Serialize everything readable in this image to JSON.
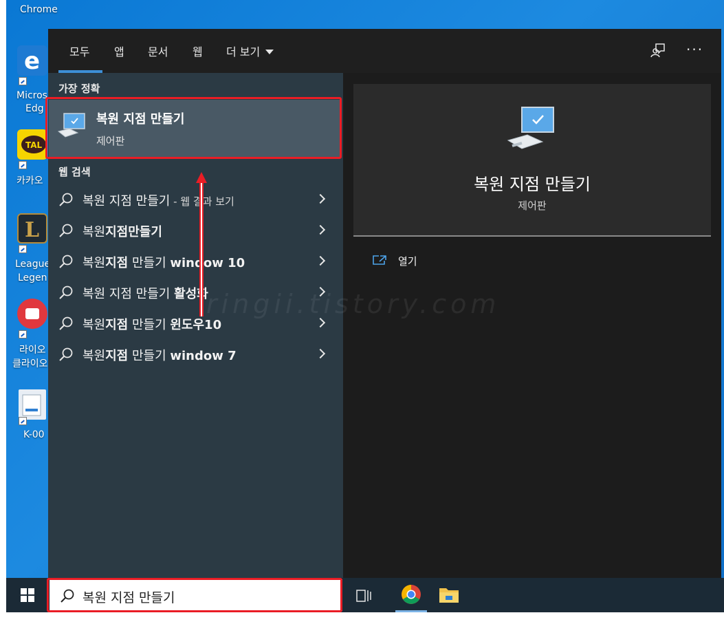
{
  "desktop": {
    "icons": [
      {
        "label": "Chrome"
      },
      {
        "label": "Micros"
      },
      {
        "label": "Edg"
      },
      {
        "label": "카카오"
      },
      {
        "label": "League"
      },
      {
        "label": "Legen"
      },
      {
        "label": "라이오"
      },
      {
        "label": "클라이오"
      },
      {
        "label": "K-00"
      }
    ]
  },
  "header": {
    "tabs": [
      {
        "label": "모두"
      },
      {
        "label": "앱"
      },
      {
        "label": "문서"
      },
      {
        "label": "웹"
      },
      {
        "label": "더 보기"
      }
    ],
    "more_options": "···"
  },
  "best_match": {
    "heading": "가장 정확",
    "title": "복원 지점 만들기",
    "subtitle": "제어판"
  },
  "web_search": {
    "heading": "웹 검색",
    "items": [
      {
        "plain": "복원 지점 만들기",
        "bold": "",
        "suffix": " - 웹 결과 보기"
      },
      {
        "plain": "복원",
        "bold": "지점만들기",
        "suffix": ""
      },
      {
        "plain": "복원",
        "bold": "지점",
        "tail": " 만들기 ",
        "bold2": "window 10"
      },
      {
        "plain": "복원 지점 만들기 ",
        "bold": "활성화",
        "suffix": ""
      },
      {
        "plain": "복원",
        "bold": "지점",
        "tail": " 만들기 ",
        "bold2": "윈도우10"
      },
      {
        "plain": "복원",
        "bold": "지점",
        "tail": " 만들기 ",
        "bold2": "window 7"
      }
    ]
  },
  "preview": {
    "title": "복원 지점 만들기",
    "subtitle": "제어판",
    "open_label": "열기"
  },
  "watermark": "ringii.tistory.com",
  "taskbar": {
    "search_value": "복원 지점 만들기"
  },
  "colors": {
    "accent": "#3d8fd6",
    "highlight": "#ea1d25",
    "left_pane": "#2b3a44",
    "right_pane": "#1c1c1c"
  }
}
